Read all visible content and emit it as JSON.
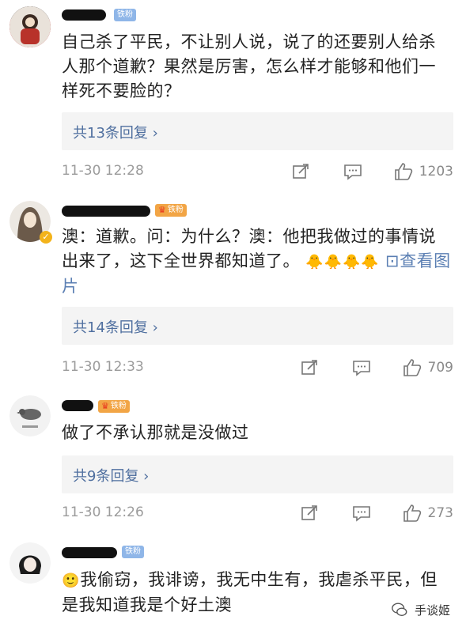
{
  "comments": [
    {
      "badge": "铁粉",
      "text": "自己杀了平民，不让别人说，说了的还要别人给杀人那个道歉？果然是厉害，怎么样才能够和他们一样死不要脸的？",
      "reply_label": "共13条回复 ›",
      "time": "11-30 12:28",
      "likes": "1203"
    },
    {
      "badge": "铁粉",
      "text": "澳：道歉。问：为什么？澳：他把我做过的事情说出来了，这下全世界都知道了。",
      "emoji_text": "🐥🐥🐥🐥",
      "link_text": "⊡查看图片",
      "reply_label": "共14条回复 ›",
      "time": "11-30 12:33",
      "likes": "709"
    },
    {
      "badge": "铁粉",
      "text": "做了不承认那就是没做过",
      "reply_label": "共9条回复 ›",
      "time": "11-30 12:26",
      "likes": "273"
    },
    {
      "badge": "铁粉",
      "emoji_text": "🙂",
      "text": "我偷窃，我诽谤，我无中生有，我虐杀平民，但是我知道我是个好土澳"
    }
  ],
  "watermark": {
    "text": "手谈姬"
  },
  "icons": [
    "share-icon",
    "comment-icon",
    "like-icon",
    "wechat-icon"
  ]
}
